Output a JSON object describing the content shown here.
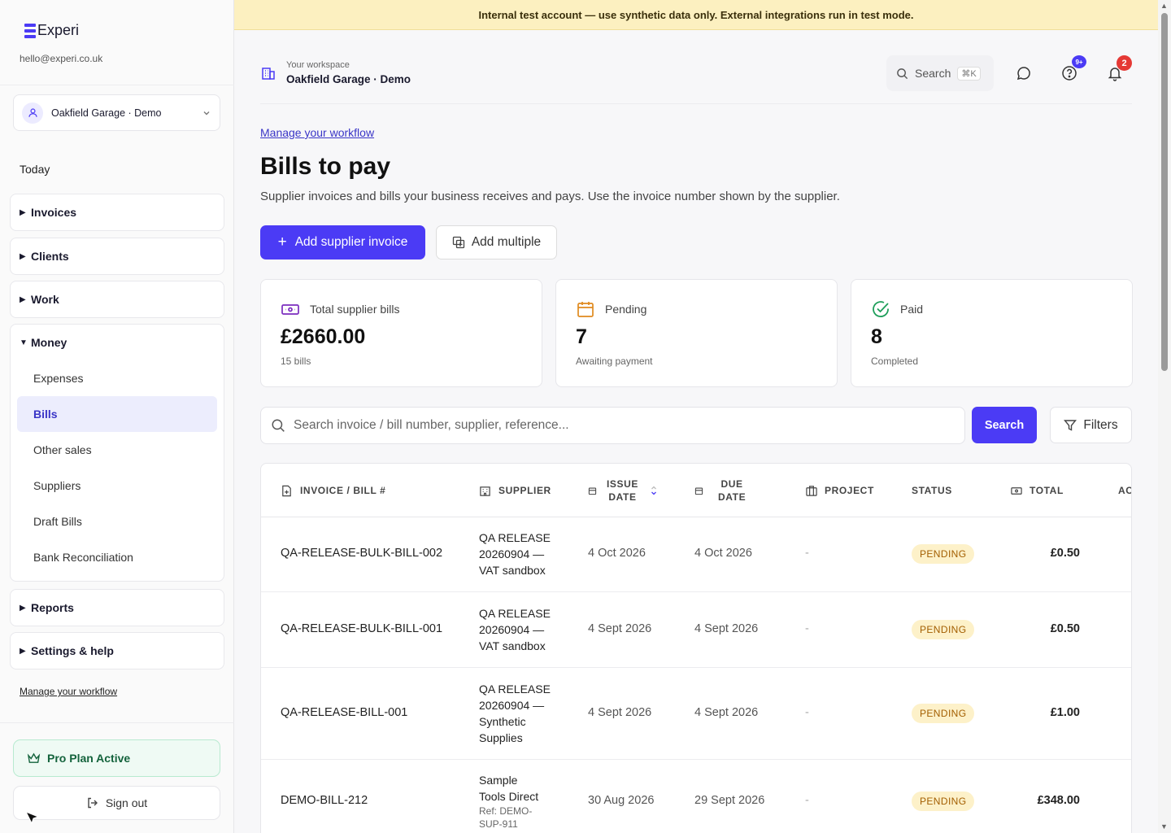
{
  "brand": {
    "name": "Experi",
    "email": "hello@experi.co.uk",
    "accent": "#4b3bf5"
  },
  "workspace_select": {
    "name": "Oakfield Garage · Demo"
  },
  "sidebar": {
    "today": "Today",
    "groups": [
      {
        "label": "Invoices",
        "expanded": false
      },
      {
        "label": "Clients",
        "expanded": false
      },
      {
        "label": "Work",
        "expanded": false
      },
      {
        "label": "Money",
        "expanded": true,
        "items": [
          "Expenses",
          "Bills",
          "Other sales",
          "Suppliers",
          "Draft Bills",
          "Bank Reconciliation"
        ]
      },
      {
        "label": "Reports",
        "expanded": false
      },
      {
        "label": "Settings & help",
        "expanded": false
      }
    ],
    "manage_link": "Manage your workflow",
    "pro_plan": "Pro Plan Active",
    "sign_out": "Sign out"
  },
  "banner": {
    "text": "Internal test account — use synthetic data only. External integrations run in test mode."
  },
  "header": {
    "workspace_label": "Your workspace",
    "workspace_name": "Oakfield Garage · Demo",
    "search_label": "Search",
    "search_shortcut": "⌘K",
    "help_badge": "9+",
    "notification_badge": "2"
  },
  "main": {
    "manage_link": "Manage your workflow",
    "title": "Bills to pay",
    "subtitle": "Supplier invoices and bills your business receives and pays. Use the invoice number shown by the supplier.",
    "add_button": "Add supplier invoice",
    "add_multiple_button": "Add multiple"
  },
  "stats": [
    {
      "label": "Total supplier bills",
      "value": "£2660.00",
      "note": "15 bills",
      "icon": "money-icon"
    },
    {
      "label": "Pending",
      "value": "7",
      "note": "Awaiting payment",
      "icon": "calendar-icon"
    },
    {
      "label": "Paid",
      "value": "8",
      "note": "Completed",
      "icon": "check-circle-icon"
    }
  ],
  "search": {
    "placeholder": "Search invoice / bill number, supplier, reference...",
    "button": "Search",
    "filters": "Filters"
  },
  "table": {
    "columns": {
      "invoice": "INVOICE / BILL #",
      "supplier": "SUPPLIER",
      "issue_1": "ISSUE",
      "issue_2": "DATE",
      "due_1": "DUE",
      "due_2": "DATE",
      "project": "PROJECT",
      "status": "STATUS",
      "total": "TOTAL",
      "actions": "AC"
    },
    "rows": [
      {
        "invoice": "QA-RELEASE-BULK-BILL-002",
        "supplier": [
          "QA RELEASE",
          "20260904 —",
          "VAT sandbox"
        ],
        "issue": "4 Oct 2026",
        "due": "4 Oct 2026",
        "project": "-",
        "status": "PENDING",
        "total": "£0.50"
      },
      {
        "invoice": "QA-RELEASE-BULK-BILL-001",
        "supplier": [
          "QA RELEASE",
          "20260904 —",
          "VAT sandbox"
        ],
        "issue": "4 Sept 2026",
        "due": "4 Sept 2026",
        "project": "-",
        "status": "PENDING",
        "total": "£0.50"
      },
      {
        "invoice": "QA-RELEASE-BILL-001",
        "supplier": [
          "QA RELEASE",
          "20260904 —",
          "Synthetic",
          "Supplies"
        ],
        "issue": "4 Sept 2026",
        "due": "4 Sept 2026",
        "project": "-",
        "status": "PENDING",
        "total": "£1.00"
      },
      {
        "invoice": "DEMO-BILL-212",
        "supplier": [
          "Sample",
          "Tools Direct"
        ],
        "supplier_ref": [
          "Ref: DEMO-",
          "SUP-911"
        ],
        "issue": "30 Aug 2026",
        "due": "29 Sept 2026",
        "project": "-",
        "status": "PENDING",
        "total": "£348.00"
      }
    ]
  }
}
